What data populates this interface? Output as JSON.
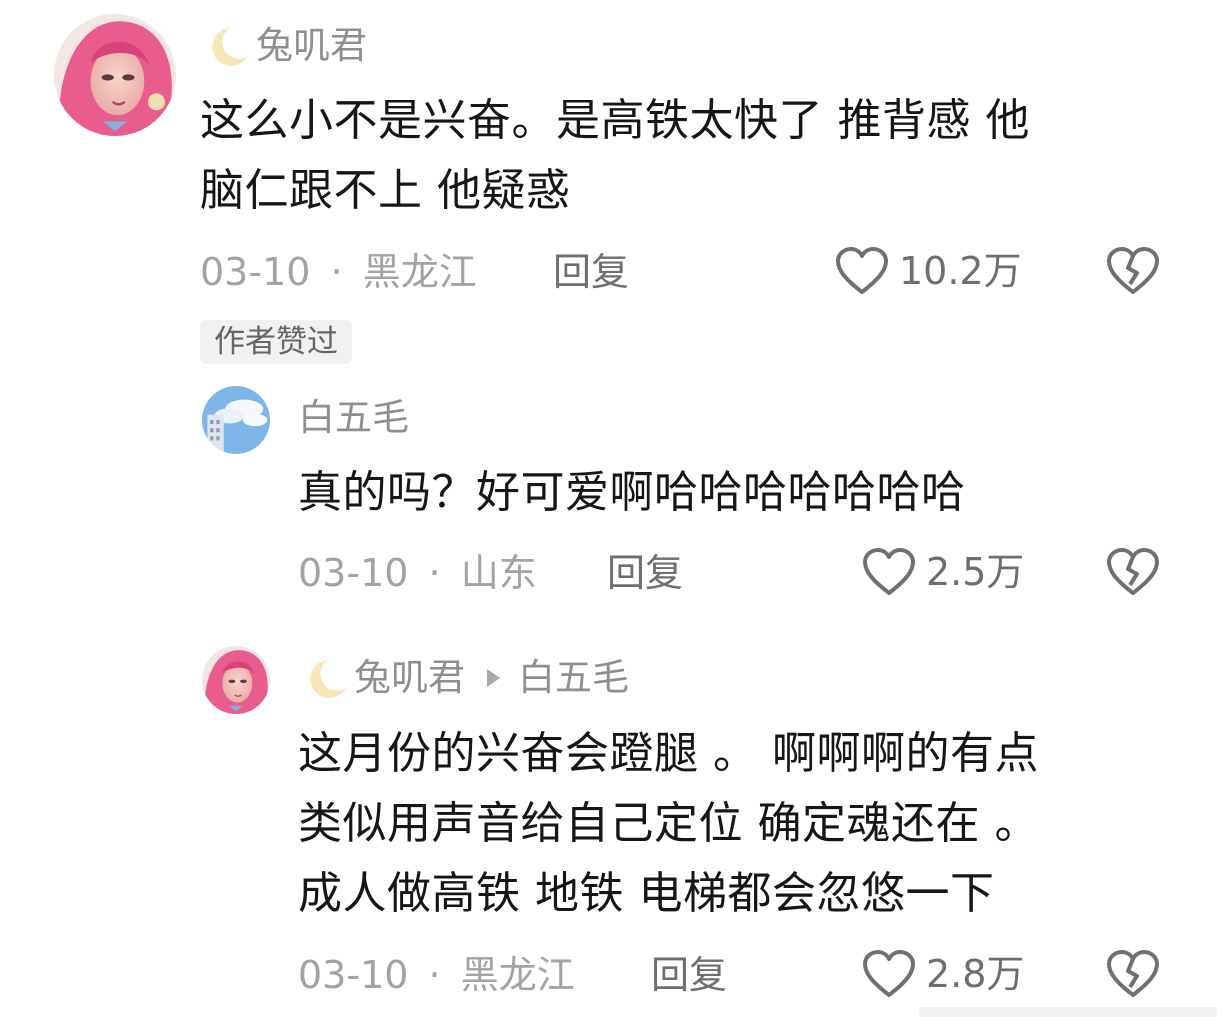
{
  "comments": [
    {
      "author": "兔叽君",
      "text_lines": [
        "这么小不是兴奋。是高铁太快了 推背感 他",
        "脑仁跟不上 他疑惑"
      ],
      "date": "03-10",
      "separator": "·",
      "location": "黑龙江",
      "reply_label": "回复",
      "likes": "10.2万",
      "badge": "作者赞过",
      "avatar_icon": "pink-hair-avatar-icon"
    },
    {
      "author": "白五毛",
      "text_lines": [
        "真的吗？好可爱啊哈哈哈哈哈哈哈"
      ],
      "date": "03-10",
      "separator": "·",
      "location": "山东",
      "reply_label": "回复",
      "likes": "2.5万",
      "avatar_icon": "sky-building-avatar-icon"
    },
    {
      "author": "兔叽君",
      "reply_to": "白五毛",
      "text_lines": [
        "这月份的兴奋会蹬腿 。 啊啊啊的有点",
        "类似用声音给自己定位 确定魂还在  。",
        "成人做高铁 地铁 电梯都会忽悠一下"
      ],
      "date": "03-10",
      "separator": "·",
      "location": "黑龙江",
      "reply_label": "回复",
      "likes": "2.8万",
      "avatar_icon": "pink-hair-avatar-icon"
    }
  ],
  "colors": {
    "text": "#161616",
    "muted": "#a3a3a3",
    "secondary": "#6e6e6e",
    "badge_bg": "#f1f1f1",
    "moon": "#f6e7b8"
  },
  "icons": {
    "like": "heart-outline-icon",
    "dislike": "broken-heart-icon",
    "moon": "crescent-moon-icon",
    "reply_arrow": "triangle-right-icon"
  }
}
